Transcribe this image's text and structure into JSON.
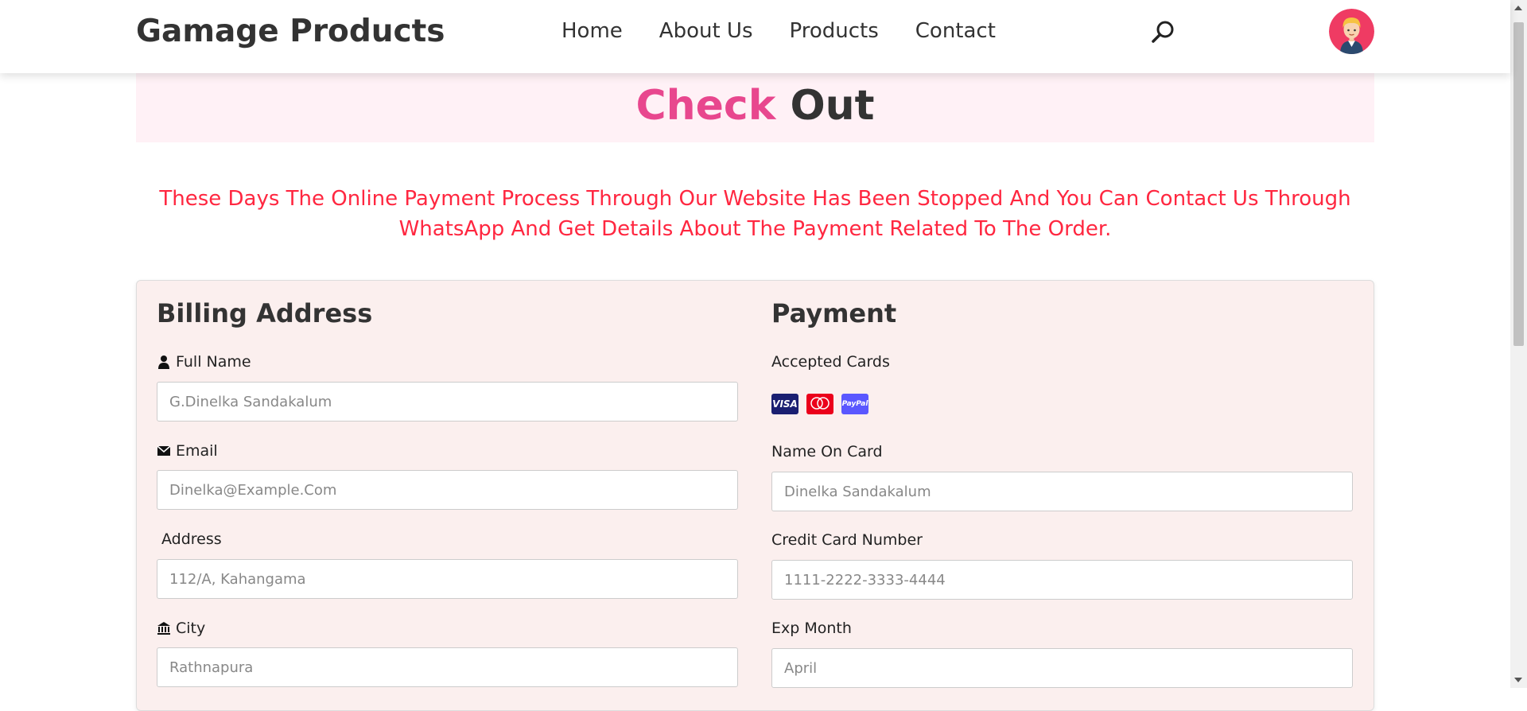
{
  "header": {
    "brand": "Gamage Products",
    "nav": [
      "Home",
      "About Us",
      "Products",
      "Contact"
    ],
    "search_icon": "search-icon",
    "avatar_icon": "user-avatar"
  },
  "banner": {
    "title_part1": "Check",
    "title_part2": "Out",
    "accent_color": "#e8478e"
  },
  "notice": {
    "line1": "These Days The Online Payment Process Through Our Website Has Been Stopped And You Can Contact Us Through",
    "line2": "WhatsApp And Get Details About The Payment Related To The Order.",
    "color": "#ff2740"
  },
  "billing": {
    "title": "Billing Address",
    "full_name_label": "Full Name",
    "full_name_placeholder": "G.Dinelka Sandakalum",
    "email_label": "Email",
    "email_placeholder": "Dinelka@Example.Com",
    "address_label": "Address",
    "address_placeholder": "112/A, Kahangama",
    "city_label": "City",
    "city_placeholder": "Rathnapura"
  },
  "payment": {
    "title": "Payment",
    "accepted_cards_label": "Accepted Cards",
    "cards": [
      "VISA",
      "MasterCard",
      "PayPal"
    ],
    "name_on_card_label": "Name On Card",
    "name_on_card_placeholder": "Dinelka Sandakalum",
    "card_number_label": "Credit Card Number",
    "card_number_placeholder": "1111-2222-3333-4444",
    "exp_month_label": "Exp Month",
    "exp_month_placeholder": "April"
  }
}
